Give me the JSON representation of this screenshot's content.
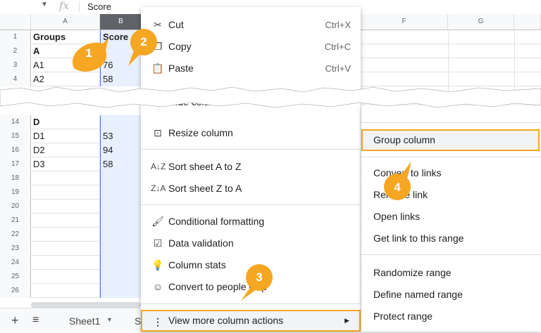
{
  "formula_bar": {
    "fx": "fx",
    "value": "Score"
  },
  "columns": [
    "A",
    "B",
    "F",
    "G"
  ],
  "rows_top": [
    {
      "num": "1",
      "a": "Groups",
      "b": "Score",
      "bold": true
    },
    {
      "num": "2",
      "a": "A",
      "b": "",
      "bold": true
    },
    {
      "num": "3",
      "a": "A1",
      "b": "76",
      "bold": false
    },
    {
      "num": "4",
      "a": "A2",
      "b": "58",
      "bold": false
    }
  ],
  "rows_bottom": [
    {
      "num": "14",
      "a": "D",
      "b": "",
      "bold": true
    },
    {
      "num": "15",
      "a": "D1",
      "b": "53",
      "bold": false
    },
    {
      "num": "16",
      "a": "D2",
      "b": "94",
      "bold": false
    },
    {
      "num": "17",
      "a": "D3",
      "b": "58",
      "bold": false
    },
    {
      "num": "18",
      "a": "",
      "b": "",
      "bold": false
    },
    {
      "num": "19",
      "a": "",
      "b": "",
      "bold": false
    },
    {
      "num": "20",
      "a": "",
      "b": "",
      "bold": false
    },
    {
      "num": "21",
      "a": "",
      "b": "",
      "bold": false
    },
    {
      "num": "22",
      "a": "",
      "b": "",
      "bold": false
    },
    {
      "num": "23",
      "a": "",
      "b": "",
      "bold": false
    },
    {
      "num": "24",
      "a": "",
      "b": "",
      "bold": false
    },
    {
      "num": "25",
      "a": "",
      "b": "",
      "bold": false
    },
    {
      "num": "26",
      "a": "",
      "b": "",
      "bold": false
    }
  ],
  "context_menu": {
    "cut": {
      "label": "Cut",
      "shortcut": "Ctrl+X"
    },
    "copy": {
      "label": "Copy",
      "shortcut": "Ctrl+C"
    },
    "paste": {
      "label": "Paste",
      "shortcut": "Ctrl+V"
    },
    "hide": {
      "label": "Hide column"
    },
    "resize": {
      "label": "Resize column"
    },
    "sort_az": {
      "label": "Sort sheet A to Z"
    },
    "sort_za": {
      "label": "Sort sheet Z to A"
    },
    "cond_format": {
      "label": "Conditional formatting"
    },
    "data_validation": {
      "label": "Data validation"
    },
    "column_stats": {
      "label": "Column stats"
    },
    "convert_people": {
      "label": "Convert to people chip"
    },
    "view_more": {
      "label": "View more column actions"
    }
  },
  "submenu": {
    "group": "Group column",
    "convert_links": "Convert to links",
    "remove_link": "Remove link",
    "open_links": "Open links",
    "get_link": "Get link to this range",
    "randomize": "Randomize range",
    "define_named": "Define named range",
    "protect": "Protect range"
  },
  "sheet_tabs": {
    "add": "+",
    "list": "≡",
    "sheet1": "Sheet1",
    "next": "S"
  },
  "callouts": [
    "1",
    "2",
    "3",
    "4"
  ],
  "colors": {
    "accent": "#f5a623",
    "selection": "#e8f0fe",
    "selection_border": "#4a7be0"
  }
}
